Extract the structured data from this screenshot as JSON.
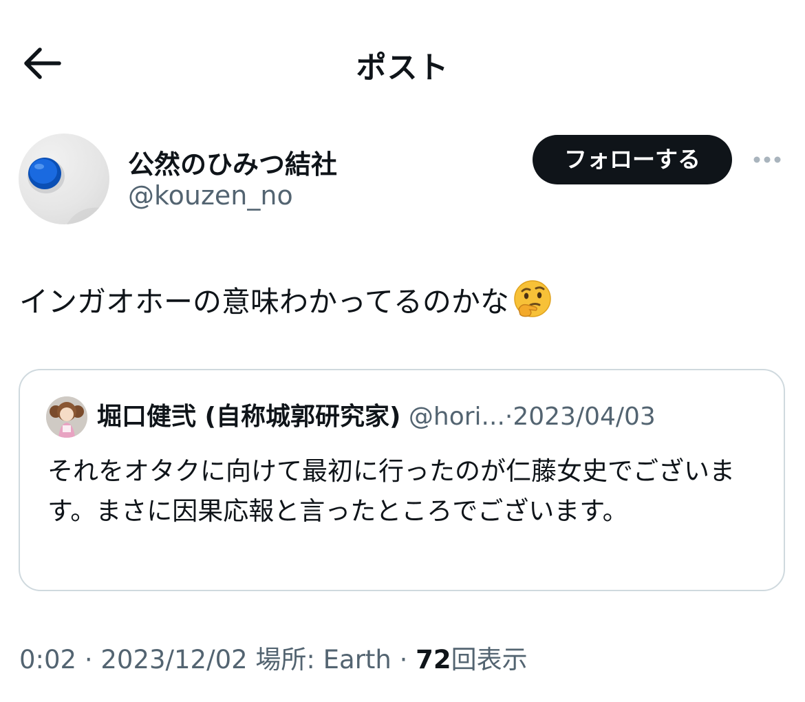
{
  "header": {
    "title": "ポスト",
    "back_icon": "arrow-left-icon"
  },
  "author": {
    "display_name": "公然のひみつ結社",
    "handle": "@kouzen_no",
    "follow_label": "フォローする",
    "more_icon": "more-dots-icon"
  },
  "post": {
    "text": "インガオホーの意味わかってるのかな",
    "emoji": "thinking-face-emoji"
  },
  "quote": {
    "name": "堀口健弐 (自称城郭研究家)",
    "handle": "@hori...",
    "separator": "·",
    "date": "2023/04/03",
    "body": "それをオタクに向けて最初に行ったのが仁藤女史でございます。まさに因果応報と言ったところでございます。"
  },
  "meta": {
    "time": "0:02",
    "date": "2023/12/02",
    "location": "場所: Earth",
    "separator": "·",
    "views_count": "72",
    "views_label": "回表示"
  },
  "colors": {
    "text_primary": "#0f1419",
    "text_secondary": "#536471",
    "border": "#cfd9de",
    "follow_bg": "#0f1419"
  }
}
